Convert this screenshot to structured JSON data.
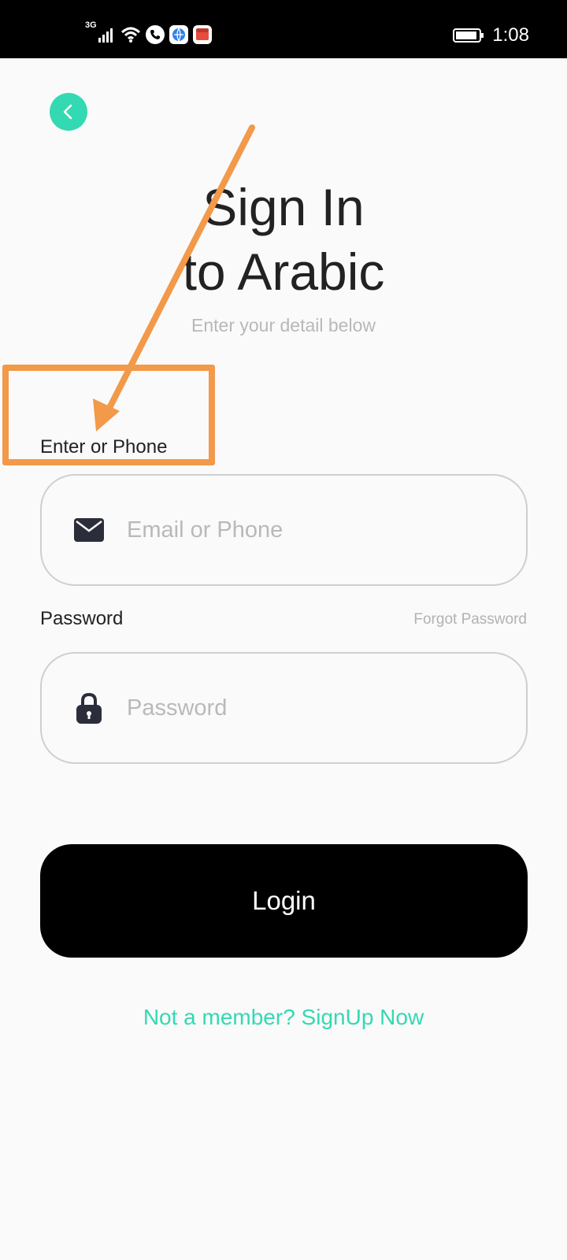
{
  "status_bar": {
    "network": "3G",
    "time": "1:08",
    "icons": [
      "signal-icon",
      "wifi-icon",
      "phone-call-icon",
      "app-globe-icon",
      "app-red-icon",
      "battery-icon"
    ]
  },
  "header": {
    "back_icon": "chevron-left-icon"
  },
  "main": {
    "title_line1": "Sign In",
    "title_line2": "to Arabic",
    "subtitle": "Enter your detail below",
    "email_label": "Enter or Phone",
    "email_placeholder": "Email or Phone",
    "email_icon": "envelope-icon",
    "password_label": "Password",
    "forgot_label": "Forgot Password",
    "password_placeholder": "Password",
    "password_icon": "lock-icon",
    "login_label": "Login",
    "signup_text": "Not a member? SignUp Now"
  },
  "colors": {
    "accent": "#33d9b2",
    "annotation": "#f2994a",
    "button": "#000000"
  }
}
